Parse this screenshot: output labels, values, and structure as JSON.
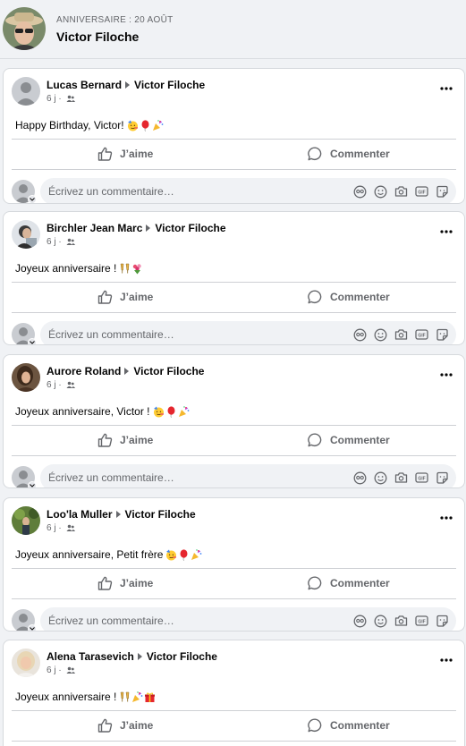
{
  "header": {
    "subtitle": "ANNIVERSAIRE : 20 AOÛT",
    "name": "Victor Filoche"
  },
  "common": {
    "like_label": "J’aime",
    "comment_label": "Commenter",
    "comment_placeholder": "Écrivez un commentaire…",
    "time": "6 j ·",
    "audience_icon": "friends-icon",
    "colors": {
      "text": "#050505",
      "secondary": "#65676b",
      "background": "#f0f2f5"
    }
  },
  "posts": [
    {
      "author": "Lucas Bernard",
      "recipient": "Victor Filoche",
      "text": "Happy Birthday, Victor!",
      "emojis": [
        "partying-face",
        "balloon",
        "party-popper"
      ]
    },
    {
      "author": "Birchler Jean Marc",
      "recipient": "Victor Filoche",
      "text": "Joyeux anniversaire !",
      "emojis": [
        "clinking-glasses",
        "bouquet"
      ]
    },
    {
      "author": "Aurore Roland",
      "recipient": "Victor Filoche",
      "text": "Joyeux anniversaire, Victor !",
      "emojis": [
        "partying-face",
        "balloon",
        "party-popper"
      ]
    },
    {
      "author": "Loo'la Muller",
      "recipient": "Victor Filoche",
      "text": "Joyeux anniversaire, Petit frère",
      "emojis": [
        "partying-face",
        "balloon",
        "party-popper"
      ]
    },
    {
      "author": "Alena Tarasevich",
      "recipient": "Victor Filoche",
      "text": "Joyeux anniversaire !",
      "emojis": [
        "clinking-glasses",
        "party-popper",
        "gift"
      ]
    }
  ]
}
